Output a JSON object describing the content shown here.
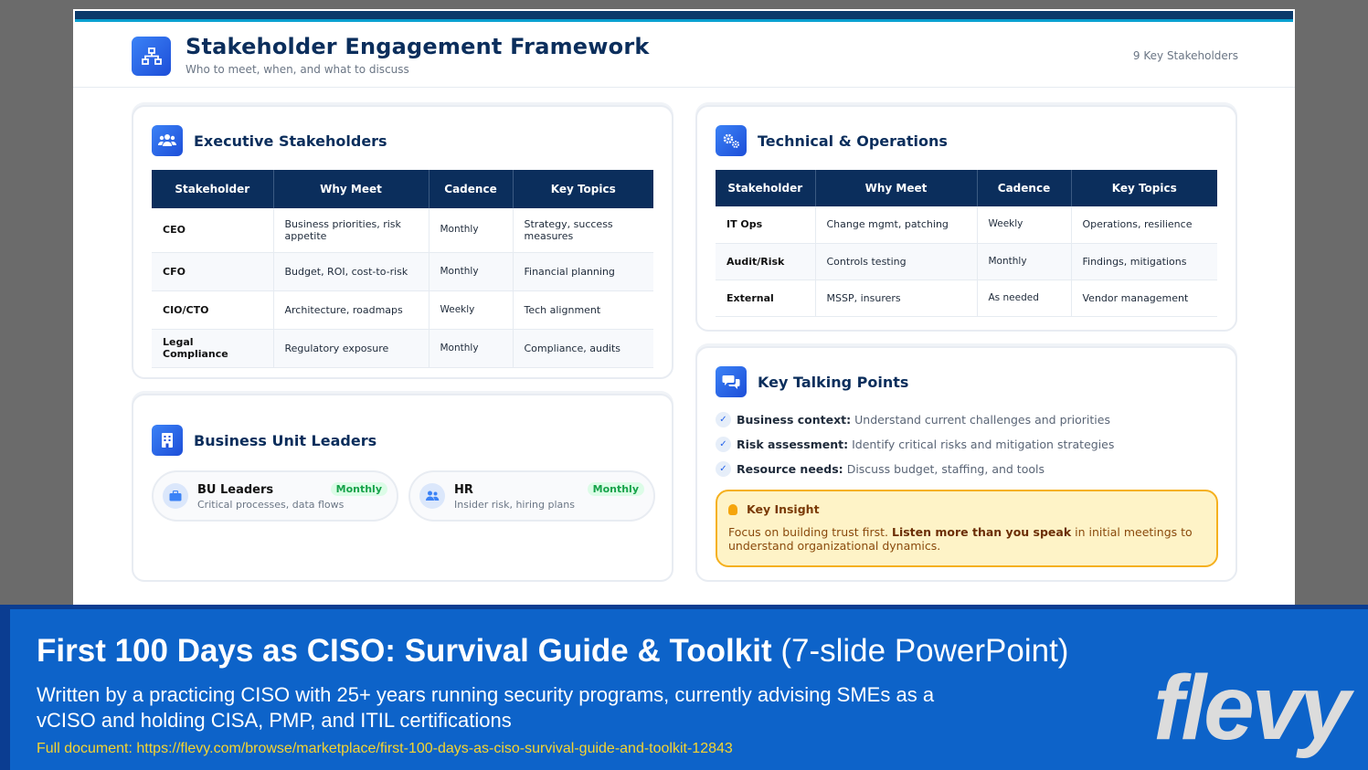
{
  "header": {
    "title": "Stakeholder Engagement Framework",
    "subtitle": "Who to meet, when, and what to discuss",
    "count": "9 Key Stakeholders"
  },
  "columns": [
    "Stakeholder",
    "Why Meet",
    "Cadence",
    "Key Topics"
  ],
  "executive": {
    "title": "Executive Stakeholders",
    "rows": [
      {
        "name": "CEO",
        "why": "Business priorities, risk appetite",
        "cadence": "Monthly",
        "topics": "Strategy, success measures"
      },
      {
        "name": "CFO",
        "why": "Budget, ROI, cost-to-risk",
        "cadence": "Monthly",
        "topics": "Financial planning"
      },
      {
        "name": "CIO/CTO",
        "why": "Architecture, roadmaps",
        "cadence": "Weekly",
        "topics": "Tech alignment"
      },
      {
        "name": "Legal Compliance",
        "why": "Regulatory exposure",
        "cadence": "Monthly",
        "topics": "Compliance, audits"
      }
    ]
  },
  "technical": {
    "title": "Technical & Operations",
    "rows": [
      {
        "name": "IT Ops",
        "why": "Change mgmt, patching",
        "cadence": "Weekly",
        "topics": "Operations, resilience"
      },
      {
        "name": "Audit/Risk",
        "why": "Controls testing",
        "cadence": "Monthly",
        "topics": "Findings, mitigations"
      },
      {
        "name": "External",
        "why": "MSSP, insurers",
        "cadence": "As needed",
        "topics": "Vendor management"
      }
    ]
  },
  "business_units": {
    "title": "Business Unit Leaders",
    "items": [
      {
        "name": "BU Leaders",
        "desc": "Critical processes, data flows",
        "cadence": "Monthly"
      },
      {
        "name": "HR",
        "desc": "Insider risk, hiring plans",
        "cadence": "Monthly"
      }
    ]
  },
  "talking_points": {
    "title": "Key Talking Points",
    "items": [
      {
        "label": "Business context:",
        "text": "Understand current challenges and priorities"
      },
      {
        "label": "Risk assessment:",
        "text": "Identify critical risks and mitigation strategies"
      },
      {
        "label": "Resource needs:",
        "text": "Discuss budget, staffing, and tools"
      }
    ],
    "insight": {
      "title": "Key Insight",
      "pre": "Focus on building trust first. ",
      "bold": "Listen more than you speak",
      "post": " in initial meetings to understand organizational dynamics."
    }
  },
  "banner": {
    "title": "First 100 Days as CISO: Survival Guide & Toolkit",
    "suffix": "(7-slide PowerPoint)",
    "description": "Written by a practicing CISO with 25+ years running security programs, currently advising SMEs as a vCISO and holding CISA, PMP, and ITIL certifications",
    "link": "Full document: https://flevy.com/browse/marketplace/first-100-days-as-ciso-survival-guide-and-toolkit-12843",
    "logo": "flevy"
  },
  "colors": {
    "navy": "#0b2e5c",
    "accent_blue": "#1d4ed8",
    "monthly": "#22a05a",
    "weekly": "#f0a020",
    "banner": "#0d63c9",
    "link": "#f5d430"
  },
  "icons": [
    "sitemap-icon",
    "users-icon",
    "gears-icon",
    "building-icon",
    "comments-icon",
    "briefcase-icon",
    "user-group-icon",
    "check-icon",
    "lightbulb-icon"
  ]
}
